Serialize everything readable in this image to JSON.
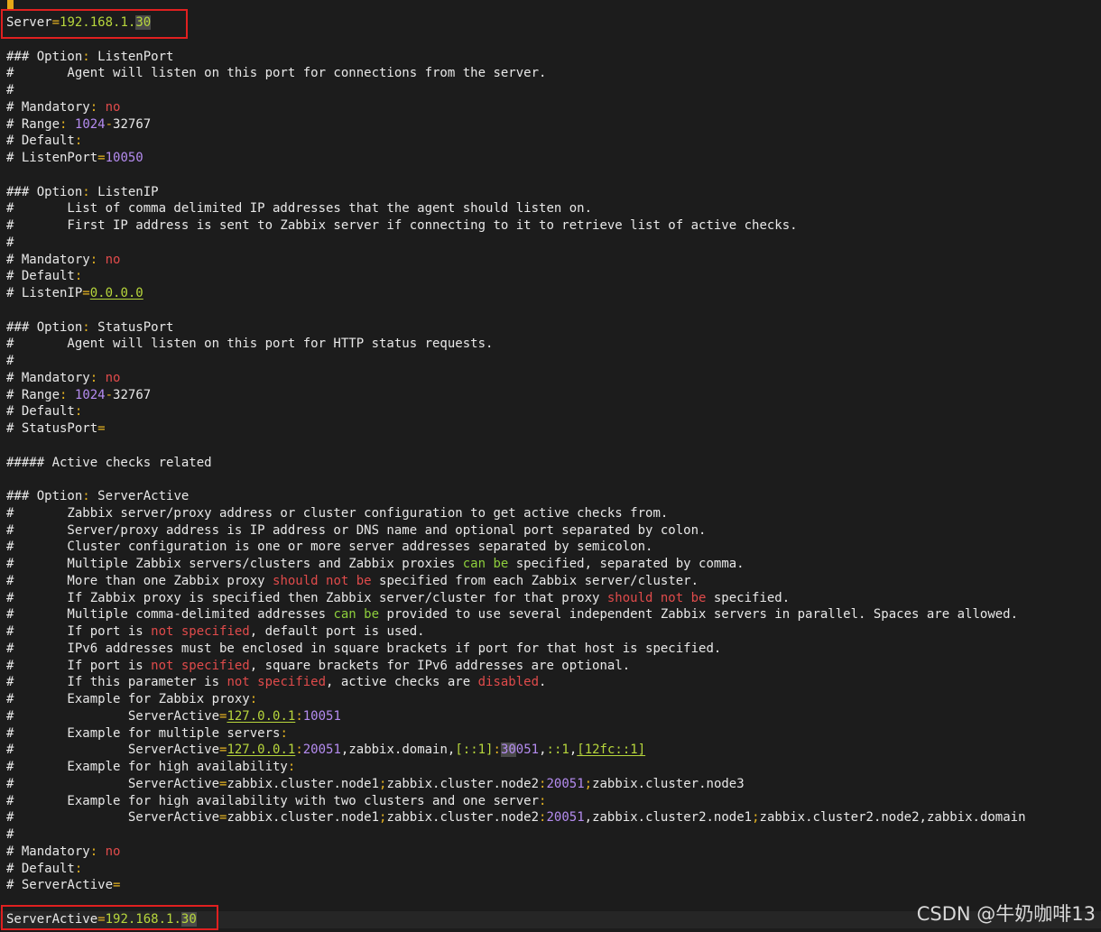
{
  "editor": {
    "lines": [
      [
        [
          "Server",
          "kw"
        ],
        [
          "=",
          "punc"
        ],
        [
          "192.168.1.",
          "ip"
        ],
        [
          "30",
          "ip-hl"
        ]
      ],
      [],
      [
        [
          "### Option",
          "kw"
        ],
        [
          ":",
          "punc"
        ],
        [
          " ListenPort",
          "kw"
        ]
      ],
      [
        [
          "#       Agent will listen on this port for connections from the server.",
          "kw"
        ]
      ],
      [
        [
          "#",
          "kw"
        ]
      ],
      [
        [
          "# Mandatory",
          "kw"
        ],
        [
          ":",
          "punc"
        ],
        [
          " ",
          "kw"
        ],
        [
          "no",
          "red"
        ]
      ],
      [
        [
          "# Range",
          "kw"
        ],
        [
          ":",
          "punc"
        ],
        [
          " ",
          "kw"
        ],
        [
          "1024",
          "num"
        ],
        [
          "-",
          "punc"
        ],
        [
          "32767",
          "kw"
        ]
      ],
      [
        [
          "# Default",
          "kw"
        ],
        [
          ":",
          "punc"
        ]
      ],
      [
        [
          "# ListenPort",
          "kw"
        ],
        [
          "=",
          "punc"
        ],
        [
          "10050",
          "num"
        ]
      ],
      [],
      [
        [
          "### Option",
          "kw"
        ],
        [
          ":",
          "punc"
        ],
        [
          " ListenIP",
          "kw"
        ]
      ],
      [
        [
          "#       List of comma delimited IP addresses that the agent should listen on.",
          "kw"
        ]
      ],
      [
        [
          "#       First IP address is sent to Zabbix server if connecting to it to retrieve list of active checks.",
          "kw"
        ]
      ],
      [
        [
          "#",
          "kw"
        ]
      ],
      [
        [
          "# Mandatory",
          "kw"
        ],
        [
          ":",
          "punc"
        ],
        [
          " ",
          "kw"
        ],
        [
          "no",
          "red"
        ]
      ],
      [
        [
          "# Default",
          "kw"
        ],
        [
          ":",
          "punc"
        ]
      ],
      [
        [
          "# ListenIP",
          "kw"
        ],
        [
          "=",
          "punc"
        ],
        [
          "0.0.0.0",
          "ip-u"
        ]
      ],
      [],
      [
        [
          "### Option",
          "kw"
        ],
        [
          ":",
          "punc"
        ],
        [
          " StatusPort",
          "kw"
        ]
      ],
      [
        [
          "#       Agent will listen on this port for HTTP status requests.",
          "kw"
        ]
      ],
      [
        [
          "#",
          "kw"
        ]
      ],
      [
        [
          "# Mandatory",
          "kw"
        ],
        [
          ":",
          "punc"
        ],
        [
          " ",
          "kw"
        ],
        [
          "no",
          "red"
        ]
      ],
      [
        [
          "# Range",
          "kw"
        ],
        [
          ":",
          "punc"
        ],
        [
          " ",
          "kw"
        ],
        [
          "1024",
          "num"
        ],
        [
          "-",
          "punc"
        ],
        [
          "32767",
          "kw"
        ]
      ],
      [
        [
          "# Default",
          "kw"
        ],
        [
          ":",
          "punc"
        ]
      ],
      [
        [
          "# StatusPort",
          "kw"
        ],
        [
          "=",
          "punc"
        ]
      ],
      [],
      [
        [
          "##### Active checks related",
          "kw"
        ]
      ],
      [],
      [
        [
          "### Option",
          "kw"
        ],
        [
          ":",
          "punc"
        ],
        [
          " ServerActive",
          "kw"
        ]
      ],
      [
        [
          "#       Zabbix server/proxy address or cluster configuration to get active checks from.",
          "kw"
        ]
      ],
      [
        [
          "#       Server/proxy address is IP address or DNS name and optional port separated by colon.",
          "kw"
        ]
      ],
      [
        [
          "#       Cluster configuration is one or more server addresses separated by semicolon.",
          "kw"
        ]
      ],
      [
        [
          "#       Multiple Zabbix servers/clusters and Zabbix proxies ",
          "kw"
        ],
        [
          "can be",
          "green"
        ],
        [
          " specified, separated by comma.",
          "kw"
        ]
      ],
      [
        [
          "#       More than one Zabbix proxy ",
          "kw"
        ],
        [
          "should not be",
          "red"
        ],
        [
          " specified from each Zabbix server/cluster.",
          "kw"
        ]
      ],
      [
        [
          "#       If Zabbix proxy is specified then Zabbix server/cluster for that proxy ",
          "kw"
        ],
        [
          "should not be",
          "red"
        ],
        [
          " specified.",
          "kw"
        ]
      ],
      [
        [
          "#       Multiple comma-delimited addresses ",
          "kw"
        ],
        [
          "can be",
          "green"
        ],
        [
          " provided to use several independent Zabbix servers in parallel. Spaces are allowed.",
          "kw"
        ]
      ],
      [
        [
          "#       If port is ",
          "kw"
        ],
        [
          "not specified",
          "red"
        ],
        [
          ", default port is used.",
          "kw"
        ]
      ],
      [
        [
          "#       IPv6 addresses must be enclosed in square brackets if port for that host is specified.",
          "kw"
        ]
      ],
      [
        [
          "#       If port is ",
          "kw"
        ],
        [
          "not specified",
          "red"
        ],
        [
          ", square brackets for IPv6 addresses are optional.",
          "kw"
        ]
      ],
      [
        [
          "#       If this parameter is ",
          "kw"
        ],
        [
          "not specified",
          "red"
        ],
        [
          ", active checks are ",
          "kw"
        ],
        [
          "disabled",
          "red"
        ],
        [
          ".",
          "kw"
        ]
      ],
      [
        [
          "#       Example for Zabbix proxy",
          "kw"
        ],
        [
          ":",
          "punc"
        ]
      ],
      [
        [
          "#               ServerActive",
          "kw"
        ],
        [
          "=",
          "punc"
        ],
        [
          "127.0.0.1",
          "ip-u"
        ],
        [
          ":",
          "punc"
        ],
        [
          "10051",
          "num"
        ]
      ],
      [
        [
          "#       Example for multiple servers",
          "kw"
        ],
        [
          ":",
          "punc"
        ]
      ],
      [
        [
          "#               ServerActive",
          "kw"
        ],
        [
          "=",
          "punc"
        ],
        [
          "127.0.0.1",
          "ip-u"
        ],
        [
          ":",
          "punc"
        ],
        [
          "20051",
          "num"
        ],
        [
          ",zabbix.domain,",
          "kw"
        ],
        [
          "[::1]",
          "ip"
        ],
        [
          ":",
          "punc"
        ],
        [
          "30",
          "num-hl"
        ],
        [
          "051",
          "num"
        ],
        [
          ",",
          "kw"
        ],
        [
          "::1",
          "ip"
        ],
        [
          ",",
          "kw"
        ],
        [
          "[12fc::1]",
          "ip-u"
        ]
      ],
      [
        [
          "#       Example for high availability",
          "kw"
        ],
        [
          ":",
          "punc"
        ]
      ],
      [
        [
          "#               ServerActive",
          "kw"
        ],
        [
          "=",
          "punc"
        ],
        [
          "zabbix.cluster.node1",
          "kw"
        ],
        [
          ";",
          "punc"
        ],
        [
          "zabbix.cluster.node2",
          "kw"
        ],
        [
          ":",
          "punc"
        ],
        [
          "20051",
          "num"
        ],
        [
          ";",
          "punc"
        ],
        [
          "zabbix.cluster.node3",
          "kw"
        ]
      ],
      [
        [
          "#       Example for high availability with two clusters and one server",
          "kw"
        ],
        [
          ":",
          "punc"
        ]
      ],
      [
        [
          "#               ServerActive",
          "kw"
        ],
        [
          "=",
          "punc"
        ],
        [
          "zabbix.cluster.node1",
          "kw"
        ],
        [
          ";",
          "punc"
        ],
        [
          "zabbix.cluster.node2",
          "kw"
        ],
        [
          ":",
          "punc"
        ],
        [
          "20051",
          "num"
        ],
        [
          ",zabbix.cluster2.node1",
          "kw"
        ],
        [
          ";",
          "punc"
        ],
        [
          "zabbix.cluster2.node2,zabbix.domain",
          "kw"
        ]
      ],
      [
        [
          "#",
          "kw"
        ]
      ],
      [
        [
          "# Mandatory",
          "kw"
        ],
        [
          ":",
          "punc"
        ],
        [
          " ",
          "kw"
        ],
        [
          "no",
          "red"
        ]
      ],
      [
        [
          "# Default",
          "kw"
        ],
        [
          ":",
          "punc"
        ]
      ],
      [
        [
          "# ServerActive",
          "kw"
        ],
        [
          "=",
          "punc"
        ]
      ],
      [],
      [
        [
          "ServerActive",
          "kw"
        ],
        [
          "=",
          "punc"
        ],
        [
          "192.168.1.",
          "ip"
        ],
        [
          "30",
          "ip-hl"
        ]
      ]
    ],
    "current_line_index": 53
  },
  "watermark": "CSDN @牛奶咖啡13",
  "colors": {
    "background": "#1c1c1c",
    "text": "#e8e8e8",
    "punctuation": "#e6b422",
    "number": "#b58cf0",
    "ip": "#b7d63c",
    "keyword_red": "#e04b4b",
    "keyword_green": "#8ecf3c",
    "annotation_box": "#e02020"
  }
}
